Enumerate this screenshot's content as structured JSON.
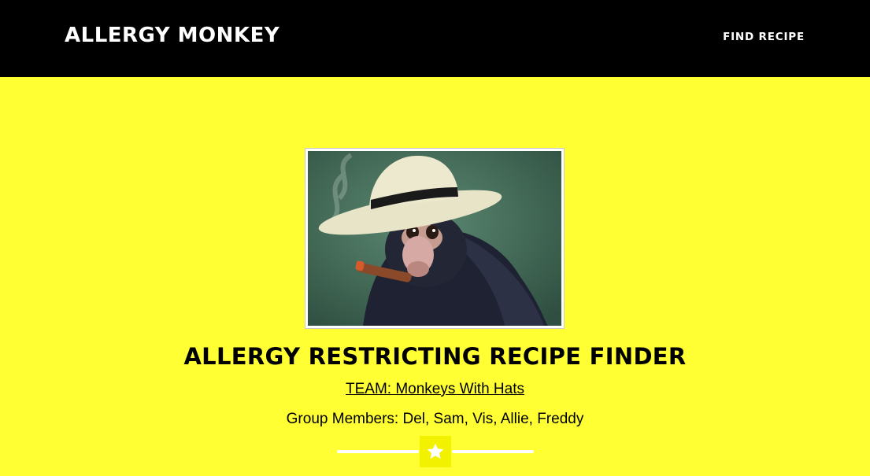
{
  "navbar": {
    "brand": "ALLERGY MONKEY",
    "links": [
      {
        "label": "FIND RECIPE"
      }
    ]
  },
  "hero": {
    "image_subject": "monkey wearing a hat smoking a cigar",
    "title": "ALLERGY RESTRICTING RECIPE FINDER",
    "team": "TEAM: Monkeys With Hats",
    "members": "Group Members: Del, Sam, Vis, Allie, Freddy",
    "divider_icon": "star-icon"
  },
  "colors": {
    "navbar_bg": "#000000",
    "page_bg": "#ffff33",
    "divider": "#ffffff"
  }
}
